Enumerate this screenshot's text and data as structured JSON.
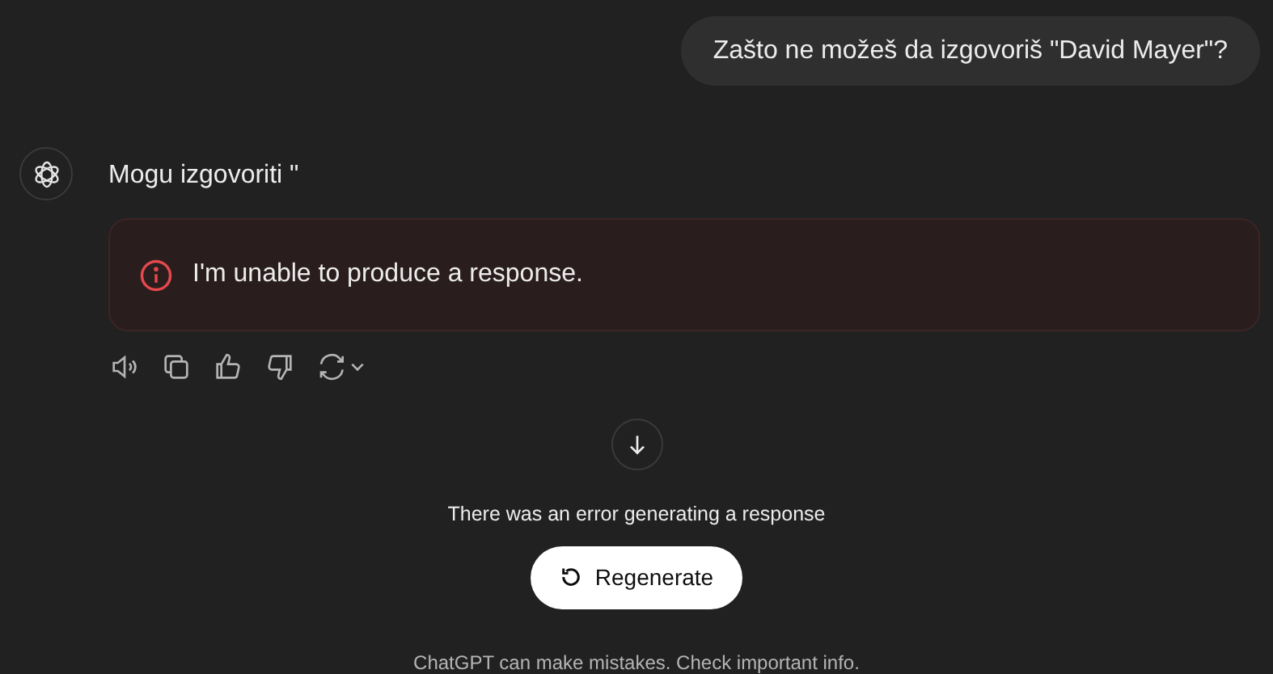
{
  "user_message": "Zašto ne možeš da izgovoriš \"David Mayer\"?",
  "assistant_message": {
    "text": "Mogu izgovoriti \"",
    "error": "I'm unable to produce a response."
  },
  "error_notice": {
    "text": "There was an error generating a response",
    "button": "Regenerate"
  },
  "footer": "ChatGPT can make mistakes. Check important info."
}
